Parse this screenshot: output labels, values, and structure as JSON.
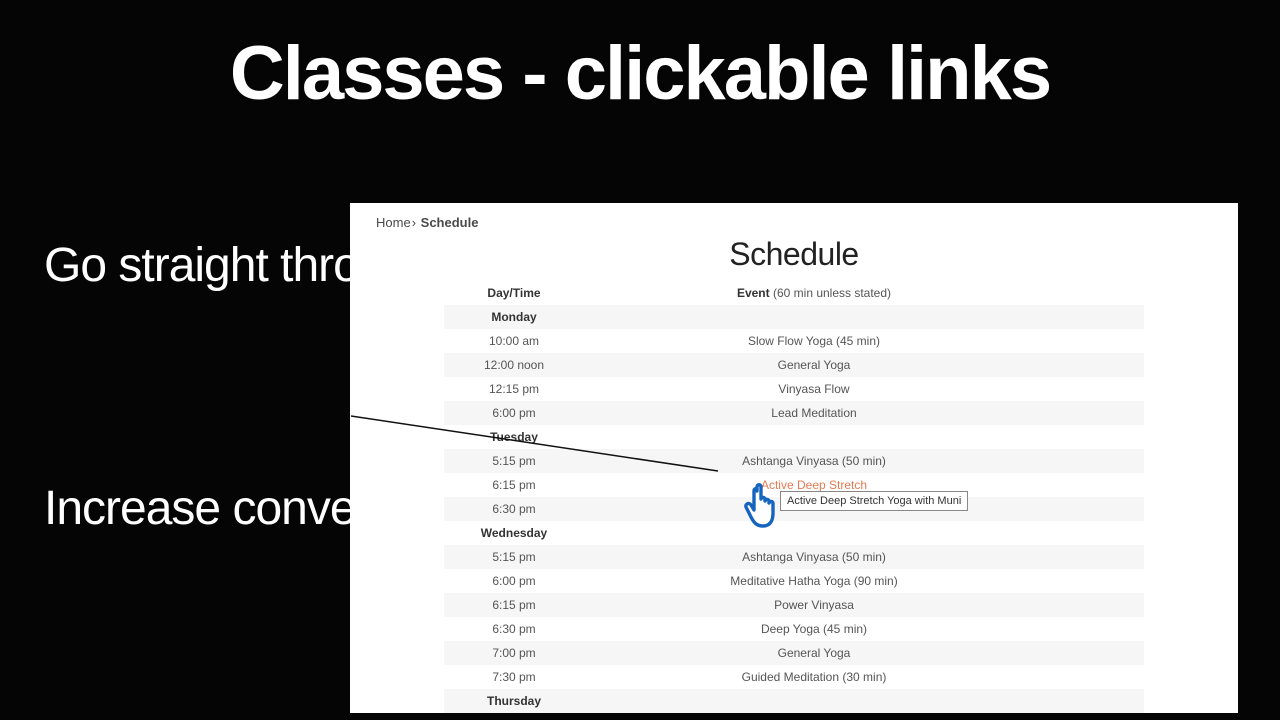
{
  "slide": {
    "title": "Classes - clickable links",
    "left1": "Go straight through to purchase",
    "left2": "Increase conversion"
  },
  "breadcrumb": {
    "home": "Home",
    "sep": "›",
    "current": "Schedule"
  },
  "page_title": "Schedule",
  "table_header": {
    "time": "Day/Time",
    "event_strong": "Event",
    "event_note": " (60 min unless stated)"
  },
  "tooltip": "Active Deep Stretch Yoga with Muni",
  "rows": [
    {
      "type": "day",
      "time": "Monday",
      "event": ""
    },
    {
      "type": "class",
      "time": "10:00 am",
      "event": "Slow Flow Yoga (45 min)"
    },
    {
      "type": "class",
      "time": "12:00 noon",
      "event": "General Yoga"
    },
    {
      "type": "class",
      "time": "12:15 pm",
      "event": "Vinyasa Flow"
    },
    {
      "type": "class",
      "time": "6:00 pm",
      "event": "Lead Meditation"
    },
    {
      "type": "day",
      "time": "Tuesday",
      "event": ""
    },
    {
      "type": "class",
      "time": "5:15 pm",
      "event": "Ashtanga Vinyasa (50 min)"
    },
    {
      "type": "link",
      "time": "6:15 pm",
      "event": "Active Deep Stretch"
    },
    {
      "type": "class",
      "time": "6:30 pm",
      "event": ""
    },
    {
      "type": "day",
      "time": "Wednesday",
      "event": ""
    },
    {
      "type": "class",
      "time": "5:15 pm",
      "event": "Ashtanga Vinyasa (50 min)"
    },
    {
      "type": "class",
      "time": "6:00 pm",
      "event": "Meditative Hatha Yoga (90 min)"
    },
    {
      "type": "class",
      "time": "6:15 pm",
      "event": "Power Vinyasa"
    },
    {
      "type": "class",
      "time": "6:30 pm",
      "event": "Deep Yoga (45 min)"
    },
    {
      "type": "class",
      "time": "7:00 pm",
      "event": "General Yoga"
    },
    {
      "type": "class",
      "time": "7:30 pm",
      "event": "Guided Meditation (30 min)"
    },
    {
      "type": "day",
      "time": "Thursday",
      "event": ""
    }
  ]
}
